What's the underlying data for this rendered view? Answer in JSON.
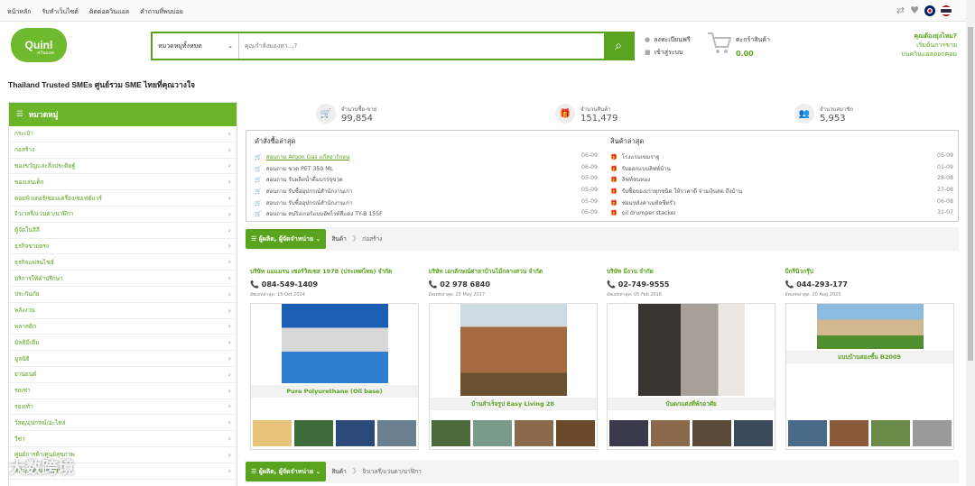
{
  "topnav": [
    "หน้าหลัก",
    "รับทำเว็บไซต์",
    "ติดต่อควินแอล",
    "คำถามที่พบบ่อย"
  ],
  "logo": {
    "text": "Quinl",
    "sub": "ควินแอล"
  },
  "search": {
    "category": "หมวดหมู่ทั้งหมด",
    "placeholder": "คุณกำลังมองหา...?"
  },
  "account": {
    "register": "ลงทะเบียนฟรี",
    "login": "เข้าสู่ระบบ"
  },
  "cart": {
    "label": "ตะกร้าสินค้า",
    "amount": "0.00"
  },
  "help": {
    "q": "คุณต้องยุ่งไหม?",
    "l1": "เริ่มต้นการขาย",
    "l2": "บนควินแอลออกคอม"
  },
  "tagline": "Thailand Trusted SMEs ศูนย์รวม SME ไทยที่คุณวางใจ",
  "sidebar": {
    "title": "หมวดหมู่",
    "items": [
      "กระเป๋า",
      "ก่อสร้าง",
      "ของขวัญและสิ่งประดิษฐ์",
      "ของเล่นเด็ก",
      "คอมพิวเตอร์/ซ่อมเครื่อง/ซอฟต์แวร์",
      "จิวเวลรี่/แว่นตา/นาฬิกา",
      "ตู้จัดในสิลี",
      "ธุรกิจขายตรง",
      "ธุรกิจแฟรนไชส์",
      "บริการให้คำปรึกษา",
      "ประกันภัย",
      "พลังงาน",
      "พลาสติก",
      "มัลติมีเดีย",
      "มูลนิธิ",
      "ยานยนต์",
      "รถเช่า",
      "รองเท้า",
      "วัสดุ/อุปกรณ์/อะไหล่",
      "วีซ่า",
      "ศูนย์การค้า/ศูนย์สุขภาพ",
      "สปา/นวดแผนไทย"
    ]
  },
  "stats": [
    {
      "label": "จำนวนซื้อ-ขาย",
      "value": "99,854",
      "icon": "cart-icon"
    },
    {
      "label": "จำนวนสินค้า",
      "value": "151,479",
      "icon": "gift-icon"
    },
    {
      "label": "จำนวนสมาชิก",
      "value": "5,953",
      "icon": "users-icon"
    }
  ],
  "orders": {
    "title": "คำสั่งซื้อล่าสุด",
    "rows": [
      {
        "text": "สอบถาม Argon Gas แก๊สอาร์กอน",
        "date": "06-09",
        "link": true
      },
      {
        "text": "สอบถาม ขวด PET 350 ML",
        "date": "06-09",
        "link": false
      },
      {
        "text": "สอบถาม รับผลิตน้ำดื่มบรรจุขวด",
        "date": "05-09",
        "link": false
      },
      {
        "text": "สอบถาม รับซื้ออุปกรณ์สำนักงานเก่า",
        "date": "05-09",
        "link": false
      },
      {
        "text": "สอบถาม รับซื้ออุปกรณ์สำนักงานเก่า",
        "date": "05-09",
        "link": false
      },
      {
        "text": "สอบถาม สปริงเกอร์แบบอัพไรท์สีแดง TY-B 155F",
        "date": "05-09",
        "link": false
      }
    ]
  },
  "products": {
    "title": "สินค้าล่าสุด",
    "rows": [
      {
        "text": "โรงแรมเขมราฐ",
        "date": "05-09"
      },
      {
        "text": "รับออกแบบลิฟท์บ้าน",
        "date": "01-09"
      },
      {
        "text": "ลิฟท์ชนทอง",
        "date": "28-08"
      },
      {
        "text": "รับซื้อของเก่าทุกชนิด ให้ราคาดี จ่ายเงินสด ถึงบ้าน",
        "date": "27-08"
      },
      {
        "text": "ซ่อมหลังคาเมทัลชีทรั่ว",
        "date": "06-08"
      },
      {
        "text": "oil drumper stacker",
        "date": "31-07"
      }
    ]
  },
  "section1": {
    "button": "ผู้ผลิต, ผู้จัดจำหน่าย",
    "crumb1": "สินค้า",
    "crumb2": "ก่อสร้าง"
  },
  "section2": {
    "button": "ผู้ผลิต, ผู้จัดจำหน่าย",
    "crumb1": "สินค้า",
    "crumb2": "จิวเวลรี่/แว่นตา/นาฬิกา"
  },
  "cards": [
    {
      "name": "บริษัท แมแมรน เซอร์วิสเซส 1978 (ประเทศไทย) จำกัด",
      "phone": "084-549-1409",
      "date": "อัพเดทล่าสุด: 15 Oct 2024",
      "product": "Pure Polyurethane (Oil base)"
    },
    {
      "name": "บริษัท เอกลักษณ์ศาลาบ้านไม้กลางสวน จำกัด",
      "phone": "02 978 6840",
      "date": "อัพเดทล่าสุด: 23 May 2017",
      "product": "บ้านสำเร็จรูป Easy Living 28"
    },
    {
      "name": "บริษัท มีงาน จำกัด",
      "phone": "02-749-9555",
      "date": "อัพเดทล่าสุด: 05 Feb 2016",
      "product": "บันตกแต่งที่พักอาศัย"
    },
    {
      "name": "บีกรีนิวกรุ๊ป",
      "phone": "044-293-177",
      "date": "อัพเดทล่าสุด: 20 Aug 2025",
      "product": "แบบบ้านสองชั้น B2009"
    }
  ],
  "watermark": "大数跨境"
}
